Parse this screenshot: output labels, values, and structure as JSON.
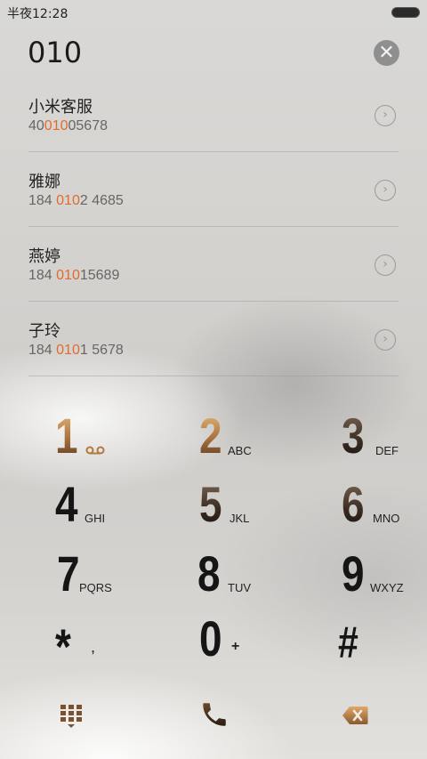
{
  "status_bar": {
    "time": "半夜12:28"
  },
  "dialer": {
    "input_value": "010"
  },
  "contacts": [
    {
      "name": "小米客服",
      "number_pre": "40",
      "number_hl": "010",
      "number_post": "05678"
    },
    {
      "name": "雅娜",
      "number_pre": "184 ",
      "number_hl": "010",
      "number_post": "2 4685"
    },
    {
      "name": "燕婷",
      "number_pre": "184 ",
      "number_hl": "010",
      "number_post": "15689"
    },
    {
      "name": "子玲",
      "number_pre": "184 ",
      "number_hl": "010",
      "number_post": "1 5678"
    }
  ],
  "keypad": [
    {
      "digit": "1",
      "letters": ""
    },
    {
      "digit": "2",
      "letters": "ABC"
    },
    {
      "digit": "3",
      "letters": "DEF"
    },
    {
      "digit": "4",
      "letters": "GHI"
    },
    {
      "digit": "5",
      "letters": "JKL"
    },
    {
      "digit": "6",
      "letters": "MNO"
    },
    {
      "digit": "7",
      "letters": "PQRS"
    },
    {
      "digit": "8",
      "letters": "TUV"
    },
    {
      "digit": "9",
      "letters": "WXYZ"
    },
    {
      "digit": "*",
      "letters": ","
    },
    {
      "digit": "0",
      "letters": "+"
    },
    {
      "digit": "#",
      "letters": ""
    }
  ],
  "icons": {
    "clear": "clear-icon",
    "contact_arrow": "chevron-right-circle-icon",
    "voicemail": "voicemail-icon",
    "keypad_toggle": "dialpad-icon",
    "call": "phone-icon",
    "backspace": "backspace-icon"
  },
  "colors": {
    "highlight": "#e36a2d",
    "call_accent": "#5a3b1f"
  }
}
